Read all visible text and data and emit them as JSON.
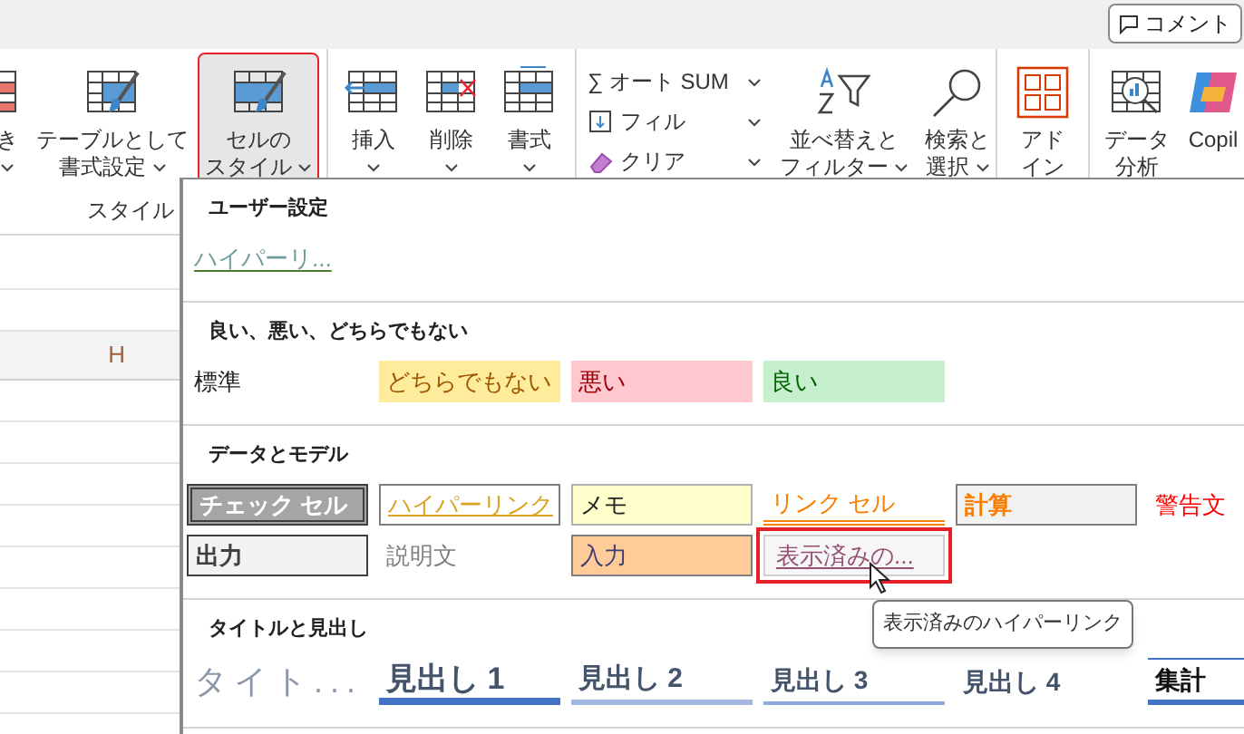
{
  "comment_button": {
    "label": "コメント"
  },
  "ribbon": {
    "groups": [
      {
        "label": "スタイル",
        "items": [
          {
            "kind": "large",
            "lines": [
              "き"
            ],
            "caret": true,
            "selected": false
          },
          {
            "kind": "large",
            "lines": [
              "テーブルとして",
              "書式設定"
            ],
            "caret": true,
            "selected": false
          },
          {
            "kind": "large",
            "lines": [
              "セルの",
              "スタイル"
            ],
            "caret": true,
            "selected": true,
            "annotated": true
          }
        ]
      },
      {
        "items": [
          {
            "kind": "large",
            "lines": [
              "挿入"
            ],
            "caret": true,
            "selected": false
          },
          {
            "kind": "large",
            "lines": [
              "削除"
            ],
            "caret": true,
            "selected": false
          },
          {
            "kind": "large",
            "lines": [
              "書式"
            ],
            "caret": true,
            "selected": false
          }
        ]
      },
      {
        "items": [
          {
            "kind": "stack",
            "entries": [
              {
                "label": "∑ オート SUM"
              },
              {
                "label": "フィル"
              },
              {
                "label": "クリア"
              }
            ]
          },
          {
            "kind": "large",
            "lines": [
              "並べ替えと",
              "フィルター"
            ],
            "caret": true,
            "selected": false
          },
          {
            "kind": "large",
            "lines": [
              "検索と",
              "選択"
            ],
            "caret": true,
            "selected": false
          }
        ]
      },
      {
        "items": [
          {
            "kind": "large",
            "lines": [
              "アド",
              "イン"
            ],
            "caret": false,
            "selected": false
          }
        ]
      },
      {
        "items": [
          {
            "kind": "large",
            "lines": [
              "データ",
              "分析"
            ],
            "caret": false,
            "selected": false
          },
          {
            "kind": "large",
            "lines": [
              "Copil"
            ],
            "caret": false,
            "selected": false
          }
        ]
      }
    ]
  },
  "sheet": {
    "column_header": "H"
  },
  "styles_menu": {
    "sections": [
      {
        "title": "ユーザー設定",
        "items": [
          {
            "kind": "custom",
            "label": "ハイパーリ..."
          }
        ]
      },
      {
        "title": "良い、悪い、どちらでもない",
        "items": [
          {
            "kind": "normal",
            "label": "標準"
          },
          {
            "kind": "neutral",
            "label": "どちらでもない"
          },
          {
            "kind": "bad",
            "label": "悪い"
          },
          {
            "kind": "good",
            "label": "良い"
          }
        ]
      },
      {
        "title": "データとモデル",
        "items": [
          {
            "kind": "check",
            "label": "チェック セル"
          },
          {
            "kind": "hyperlink",
            "label": "ハイパーリンク"
          },
          {
            "kind": "note",
            "label": "メモ"
          },
          {
            "kind": "linked",
            "label": "リンク セル"
          },
          {
            "kind": "calc",
            "label": "計算"
          },
          {
            "kind": "warning",
            "label": "警告文"
          },
          {
            "kind": "output",
            "label": "出力"
          },
          {
            "kind": "explanatory",
            "label": "説明文"
          },
          {
            "kind": "input",
            "label": "入力"
          },
          {
            "kind": "followed",
            "label": "表示済みの...",
            "hovered": true,
            "annotated": true
          }
        ]
      },
      {
        "title": "タイトルと見出し",
        "items": [
          {
            "kind": "title",
            "label": "タイト..."
          },
          {
            "kind": "h1",
            "label": "見出し 1"
          },
          {
            "kind": "h2",
            "label": "見出し 2"
          },
          {
            "kind": "h3",
            "label": "見出し 3"
          },
          {
            "kind": "h4",
            "label": "見出し 4"
          },
          {
            "kind": "total",
            "label": "集計"
          }
        ]
      }
    ],
    "tooltip": "表示済みのハイパーリンク"
  }
}
